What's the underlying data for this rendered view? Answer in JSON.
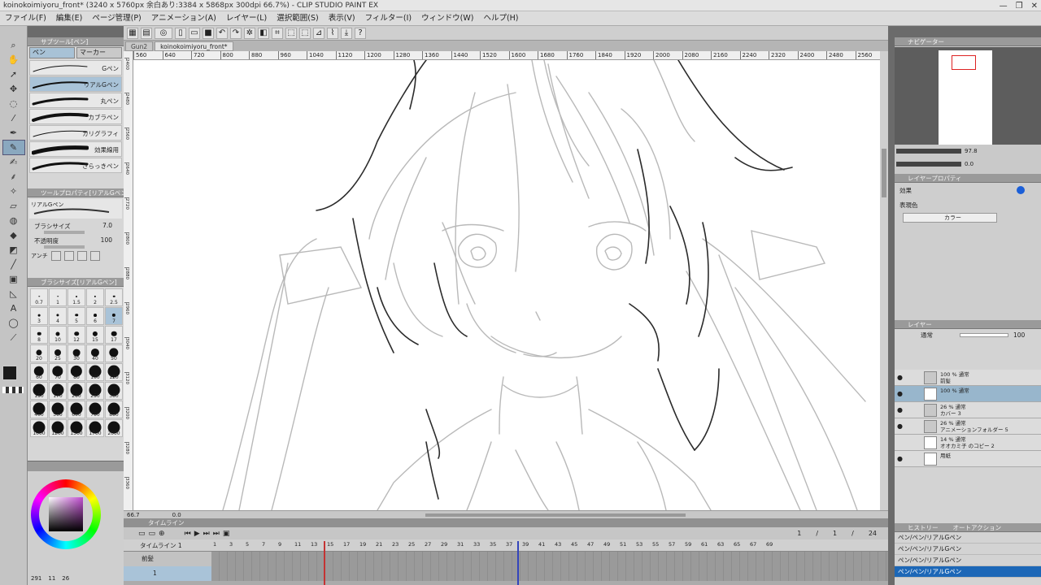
{
  "window": {
    "title": "koinokoimiyoru_front* (3240 x 5760px 余白あり:3384 x 5868px 300dpi 66.7%)  - CLIP STUDIO PAINT EX",
    "controls": [
      "—",
      "❐",
      "✕"
    ]
  },
  "menu": [
    "ファイル(F)",
    "編集(E)",
    "ページ管理(P)",
    "アニメーション(A)",
    "レイヤー(L)",
    "選択範囲(S)",
    "表示(V)",
    "フィルター(I)",
    "ウィンドウ(W)",
    "ヘルプ(H)"
  ],
  "canvas_tabs": [
    "Gun2",
    "koinokoimiyoru_front*"
  ],
  "ruler_ticks": [
    "560",
    "640",
    "720",
    "800",
    "880",
    "960",
    "1040",
    "1120",
    "1200",
    "1280",
    "1360",
    "1440",
    "1520",
    "1600",
    "1680",
    "1760",
    "1840",
    "1920",
    "2000",
    "2080",
    "2160",
    "2240",
    "2320",
    "2400",
    "2480",
    "2560"
  ],
  "ruler_left_ticks": [
    "2400",
    "2480",
    "2560",
    "2640",
    "2720",
    "2800",
    "2880",
    "2960",
    "3040",
    "3120",
    "3200",
    "3280",
    "3360"
  ],
  "status": {
    "zoom": "66.7",
    "angle": "0.0"
  },
  "subtool": {
    "title": "サブツール[ペン]",
    "tabs": [
      "ペン",
      "マーカー"
    ],
    "brushes": [
      {
        "name": "Gペン",
        "selected": false
      },
      {
        "name": "リアルGペン",
        "selected": true
      },
      {
        "name": "丸ペン",
        "selected": false
      },
      {
        "name": "カブラペン",
        "selected": false
      },
      {
        "name": "カリグラフィ",
        "selected": false
      },
      {
        "name": "効果線用",
        "selected": false
      },
      {
        "name": "さらっきペン",
        "selected": false
      }
    ]
  },
  "toolprop": {
    "title": "ツールプロパティ[リアルGペン]",
    "current_tool": "リアルGペン",
    "brush_size_label": "ブラシサイズ",
    "brush_size_value": "7.0",
    "opacity_label": "不透明度",
    "opacity_value": "100",
    "aa_label": "アンチ"
  },
  "brushsize": {
    "title": "ブラシサイズ[リアルGペン]",
    "sizes": [
      "0.7",
      "1",
      "1.5",
      "2",
      "2.5",
      "3",
      "4",
      "5",
      "6",
      "7",
      "8",
      "10",
      "12",
      "15",
      "17",
      "20",
      "25",
      "30",
      "40",
      "50",
      "60",
      "70",
      "80",
      "100",
      "120",
      "150",
      "170",
      "200",
      "250",
      "300",
      "400",
      "500",
      "600",
      "700",
      "800",
      "1000",
      "1200",
      "1500",
      "1700",
      "2000"
    ],
    "selected": "7"
  },
  "colors": {
    "main": "#1a1a1a",
    "sub": "#ffffff",
    "accent": "#8aa8bf",
    "selected_bg": "#1c67b7"
  },
  "color_status": {
    "h": "291",
    "s": "11",
    "v": "26"
  },
  "timeline": {
    "title": "タイムライン",
    "tab2": "",
    "track_label": "タイムライン 1",
    "frame_numbers": [
      "1",
      "3",
      "5",
      "7",
      "9",
      "11",
      "13",
      "15",
      "17",
      "19",
      "21",
      "23",
      "25",
      "27",
      "29",
      "31",
      "33",
      "35",
      "37",
      "39",
      "41",
      "43",
      "45",
      "47",
      "49",
      "51",
      "53",
      "55",
      "57",
      "59",
      "61",
      "63",
      "65",
      "67",
      "69"
    ],
    "counter": {
      "current": "1",
      "sep1": "/",
      "start": "1",
      "sep2": "/",
      "end": "24"
    },
    "tracks": [
      {
        "name": "前髪"
      },
      {
        "name": "1"
      }
    ]
  },
  "navigator": {
    "title": "ナビゲーター",
    "zoom": "97.8",
    "angle": "0.0"
  },
  "layerprop": {
    "title": "レイヤープロパティ",
    "effect_label": "効果",
    "expression_label": "表現色",
    "expression_value": "カラー"
  },
  "layers": {
    "title": "レイヤー",
    "blend": "通常",
    "opacity": "100",
    "items": [
      {
        "line1": "100 % 通常",
        "line2": "前髪",
        "selected": false,
        "eye": true,
        "folder": true
      },
      {
        "line1": "100 % 通常",
        "line2": "",
        "selected": true,
        "eye": true,
        "folder": false
      },
      {
        "line1": "26 % 通常",
        "line2": "カバー 3",
        "selected": false,
        "eye": true,
        "folder": true
      },
      {
        "line1": "26 % 通常",
        "line2": "アニメーションフォルダー 5",
        "selected": false,
        "eye": true,
        "folder": true
      },
      {
        "line1": "14 % 通常",
        "line2": "オオカミ子 のコピー 2",
        "selected": false,
        "eye": false,
        "folder": false
      },
      {
        "line1": "",
        "line2": "用紙",
        "selected": false,
        "eye": true,
        "folder": false
      }
    ]
  },
  "history": {
    "title": "ヒストリー",
    "tab2": "オートアクション",
    "items": [
      "ペン/ペン/リアルGペン",
      "ペン/ペン/リアルGペン",
      "ペン/ペン/リアルGペン",
      "ペン/ペン/リアルGペン"
    ]
  }
}
